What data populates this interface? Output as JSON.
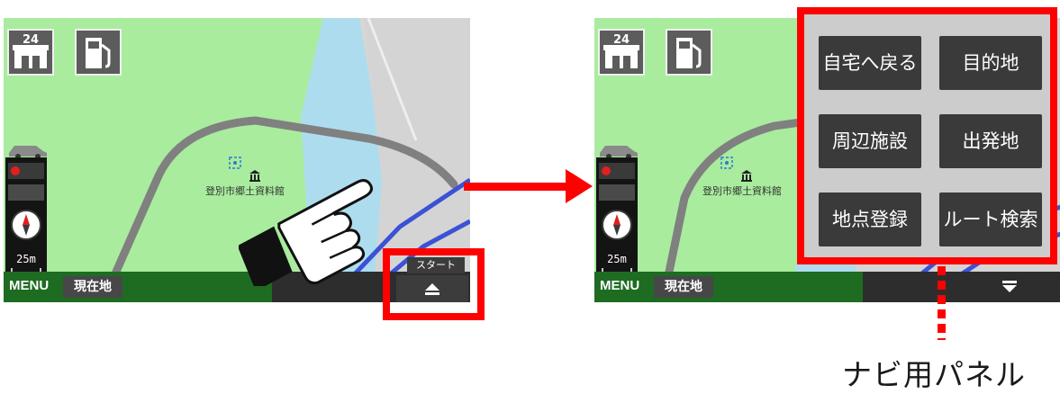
{
  "left_screen": {
    "menu_label": "MENU",
    "current_location_button": "現在地",
    "poi_label": "登別市郷土資料館",
    "start_tab_label": "スタート",
    "scale_label": "25m",
    "convenience_store_badge": "24"
  },
  "right_screen": {
    "menu_label": "MENU",
    "current_location_button": "現在地",
    "poi_label": "登別市郷土資料館",
    "scale_label": "25m",
    "convenience_store_badge": "24"
  },
  "navi_panel": {
    "buttons": [
      "自宅へ戻る",
      "目的地",
      "周辺施設",
      "出発地",
      "地点登録",
      "ルート検索"
    ],
    "caption": "ナビ用パネル"
  },
  "colors": {
    "highlight": "#ff0000",
    "park_green": "#a9ec9e",
    "water_blue": "#aedcef",
    "road_gray": "#808080",
    "route_blue": "#3b52d6",
    "bottom_bar_green": "#1e6b22"
  }
}
